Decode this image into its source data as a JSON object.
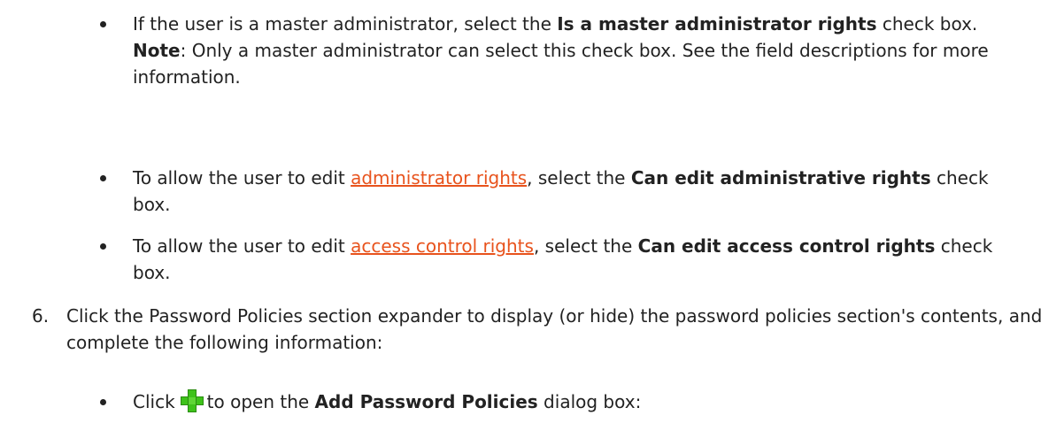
{
  "bullets": [
    {
      "pre": "If the user is a master administrator, select the ",
      "bold": "Is a master administrator rights",
      "post": " check box.",
      "note_label": "Note",
      "note_text": ": Only a master administrator can select this check box. See the field descriptions for more information."
    },
    {
      "pre": "To allow the user to edit ",
      "link": "administrator rights",
      "mid": ", select the ",
      "bold": "Can edit administrative rights",
      "post": " check box."
    },
    {
      "pre": "To allow the user to edit ",
      "link": "access control rights",
      "mid": ", select the ",
      "bold": "Can edit access control rights",
      "post": " check box."
    }
  ],
  "step6": {
    "number": "6.",
    "text": "Click the Password Policies section expander to display (or hide) the password policies section's contents, and complete the following information:"
  },
  "sub_bullet": {
    "pre": "Click",
    "icon": "add-plus-icon",
    "mid": "to open the ",
    "bold": "Add Password Policies",
    "post": " dialog box:"
  },
  "colors": {
    "link": "#e8531d",
    "icon_green": "#3ec21a"
  }
}
